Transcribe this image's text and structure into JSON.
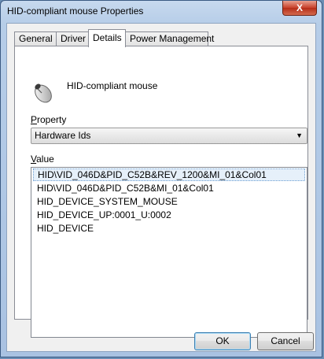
{
  "window": {
    "title": "HID-compliant mouse Properties",
    "close_glyph": "X"
  },
  "tabs": [
    {
      "label": "General",
      "active": false
    },
    {
      "label": "Driver",
      "active": false
    },
    {
      "label": "Details",
      "active": true
    },
    {
      "label": "Power Management",
      "active": false
    }
  ],
  "device": {
    "name": "HID-compliant mouse",
    "icon": "mouse-icon"
  },
  "property": {
    "label_first": "P",
    "label_rest": "roperty",
    "selected": "Hardware Ids"
  },
  "value": {
    "label_first": "V",
    "label_rest": "alue",
    "items": [
      "HID\\VID_046D&PID_C52B&REV_1200&MI_01&Col01",
      "HID\\VID_046D&PID_C52B&MI_01&Col01",
      "HID_DEVICE_SYSTEM_MOUSE",
      "HID_DEVICE_UP:0001_U:0002",
      "HID_DEVICE"
    ],
    "selected_index": 0
  },
  "buttons": {
    "ok": "OK",
    "cancel": "Cancel"
  },
  "colors": {
    "accent": "#3c7fb1",
    "close": "#c7402a"
  }
}
